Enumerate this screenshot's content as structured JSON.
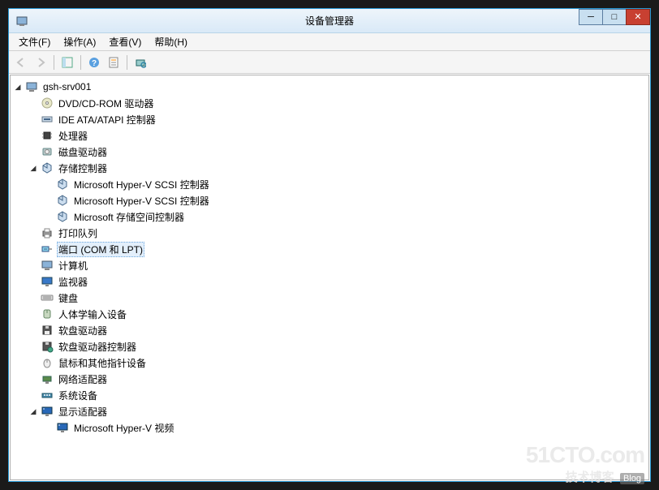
{
  "window": {
    "title": "设备管理器",
    "controls": {
      "minimize": "─",
      "maximize": "□",
      "close": "✕"
    }
  },
  "menu": {
    "file": "文件(F)",
    "action": "操作(A)",
    "view": "查看(V)",
    "help": "帮助(H)"
  },
  "tree": {
    "root": "gsh-srv001",
    "items": [
      {
        "label": "DVD/CD-ROM 驱动器",
        "icon": "disc"
      },
      {
        "label": "IDE ATA/ATAPI 控制器",
        "icon": "ide"
      },
      {
        "label": "处理器",
        "icon": "cpu"
      },
      {
        "label": "磁盘驱动器",
        "icon": "disk"
      },
      {
        "label": "存储控制器",
        "icon": "storage",
        "expanded": true,
        "children": [
          {
            "label": "Microsoft Hyper-V SCSI 控制器",
            "icon": "storage"
          },
          {
            "label": "Microsoft Hyper-V SCSI 控制器",
            "icon": "storage"
          },
          {
            "label": "Microsoft 存储空间控制器",
            "icon": "storage"
          }
        ]
      },
      {
        "label": "打印队列",
        "icon": "printer"
      },
      {
        "label": "端口 (COM 和 LPT)",
        "icon": "port",
        "selected": true
      },
      {
        "label": "计算机",
        "icon": "computer"
      },
      {
        "label": "监视器",
        "icon": "monitor"
      },
      {
        "label": "键盘",
        "icon": "keyboard"
      },
      {
        "label": "人体学输入设备",
        "icon": "hid"
      },
      {
        "label": "软盘驱动器",
        "icon": "floppy"
      },
      {
        "label": "软盘驱动器控制器",
        "icon": "floppyctrl"
      },
      {
        "label": "鼠标和其他指针设备",
        "icon": "mouse"
      },
      {
        "label": "网络适配器",
        "icon": "network"
      },
      {
        "label": "系统设备",
        "icon": "system"
      },
      {
        "label": "显示适配器",
        "icon": "display",
        "expanded": true,
        "children": [
          {
            "label": "Microsoft Hyper-V 视频",
            "icon": "display"
          }
        ]
      }
    ]
  },
  "watermark": {
    "line1": "51CTO.com",
    "line2": "技术博客",
    "badge": "Blog"
  }
}
